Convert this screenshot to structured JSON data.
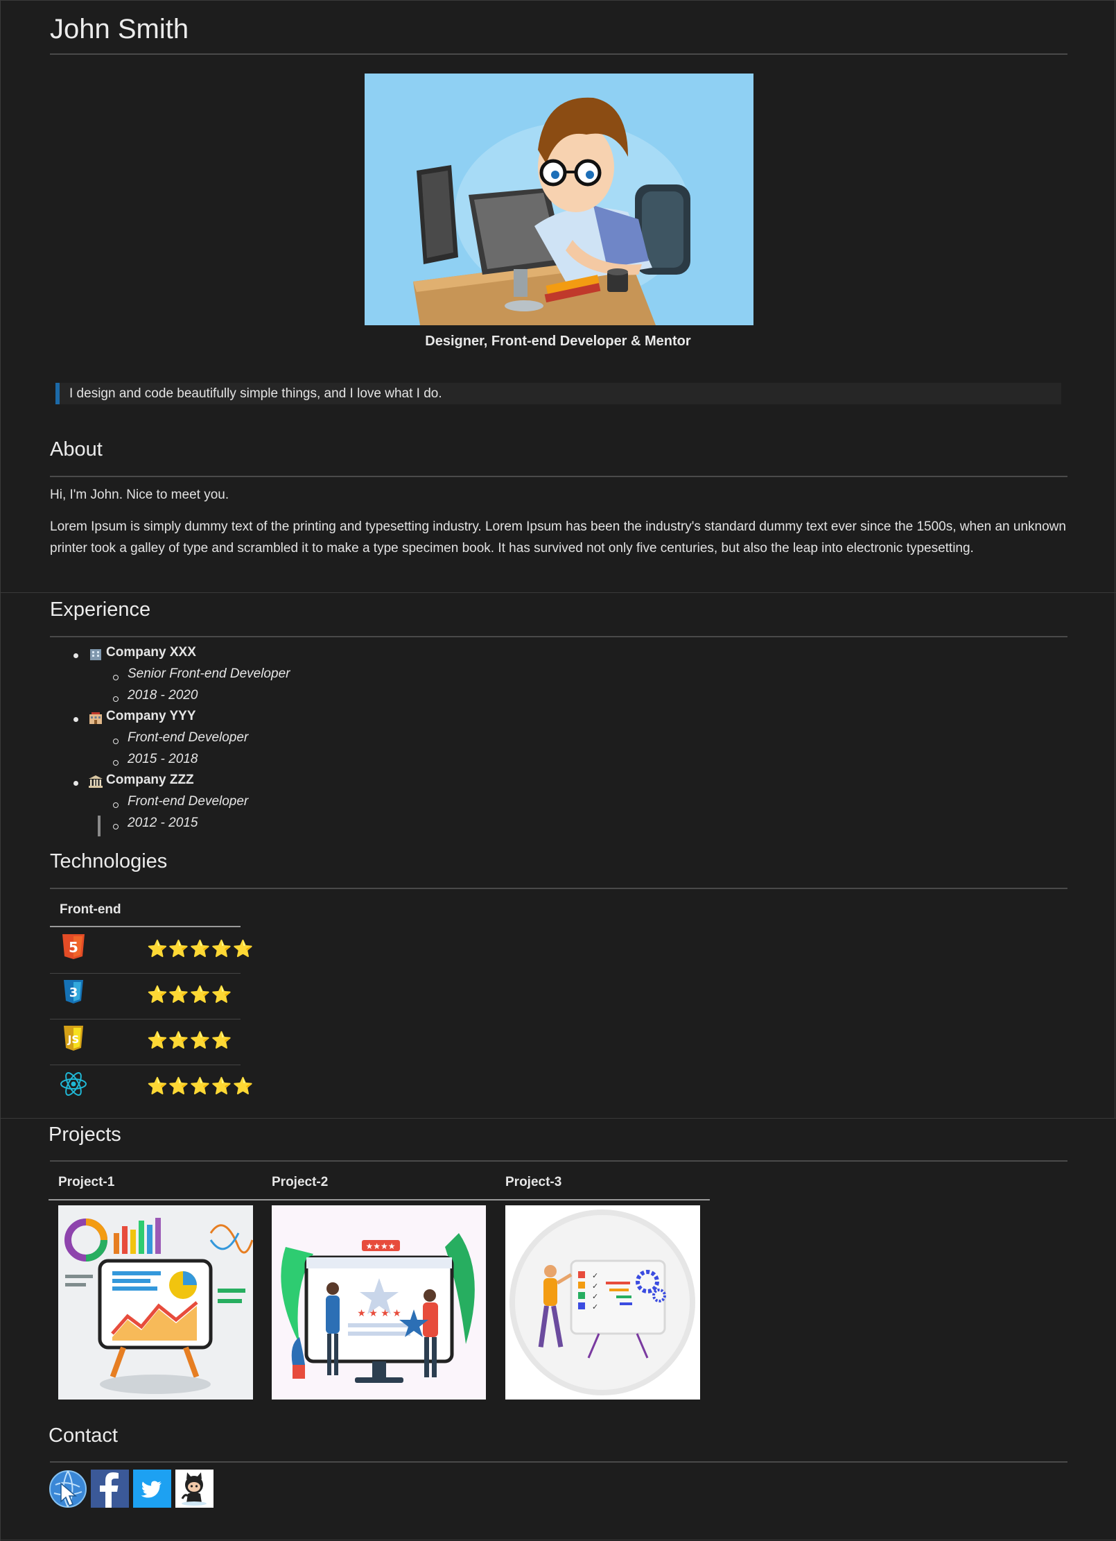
{
  "name": "John Smith",
  "caption": "Designer, Front-end Developer & Mentor",
  "quote": "I design and code beautifully simple things, and I love what I do.",
  "about": {
    "title": "About",
    "greeting": "Hi, I'm John. Nice to meet you.",
    "body": "Lorem Ipsum is simply dummy text of the printing and typesetting industry. Lorem Ipsum has been the industry's standard dummy text ever since the 1500s, when an unknown printer took a galley of type and scrambled it to make a type specimen book. It has survived not only five centuries, but also the leap into electronic typesetting."
  },
  "experience": {
    "title": "Experience",
    "items": [
      {
        "company": "Company XXX",
        "icon": "office-building-icon",
        "role": "Senior Front-end Developer",
        "years": "2018 - 2020"
      },
      {
        "company": "Company YYY",
        "icon": "hotel-building-icon",
        "role": "Front-end Developer",
        "years": "2015 - 2018"
      },
      {
        "company": "Company ZZZ",
        "icon": "classical-building-icon",
        "role": "Front-end Developer",
        "years": "2012 - 2015"
      }
    ]
  },
  "technologies": {
    "title": "Technologies",
    "header": "Front-end",
    "rows": [
      {
        "icon": "html5-icon",
        "stars": "⭐⭐⭐⭐⭐",
        "rating": 5
      },
      {
        "icon": "css3-icon",
        "stars": "⭐⭐⭐⭐",
        "rating": 4
      },
      {
        "icon": "javascript-icon",
        "stars": "⭐⭐⭐⭐",
        "rating": 4
      },
      {
        "icon": "react-icon",
        "stars": "⭐⭐⭐⭐⭐",
        "rating": 5
      }
    ]
  },
  "projects": {
    "title": "Projects",
    "items": [
      {
        "label": "Project-1"
      },
      {
        "label": "Project-2"
      },
      {
        "label": "Project-3"
      }
    ]
  },
  "contact": {
    "title": "Contact",
    "links": [
      "website-icon",
      "facebook-icon",
      "twitter-icon",
      "github-icon"
    ]
  },
  "colors": {
    "background": "#1d1d1d",
    "quote_accent": "#1c6aa8",
    "star": "#f8c630",
    "twitter": "#1da1f2",
    "facebook": "#3b5998"
  }
}
